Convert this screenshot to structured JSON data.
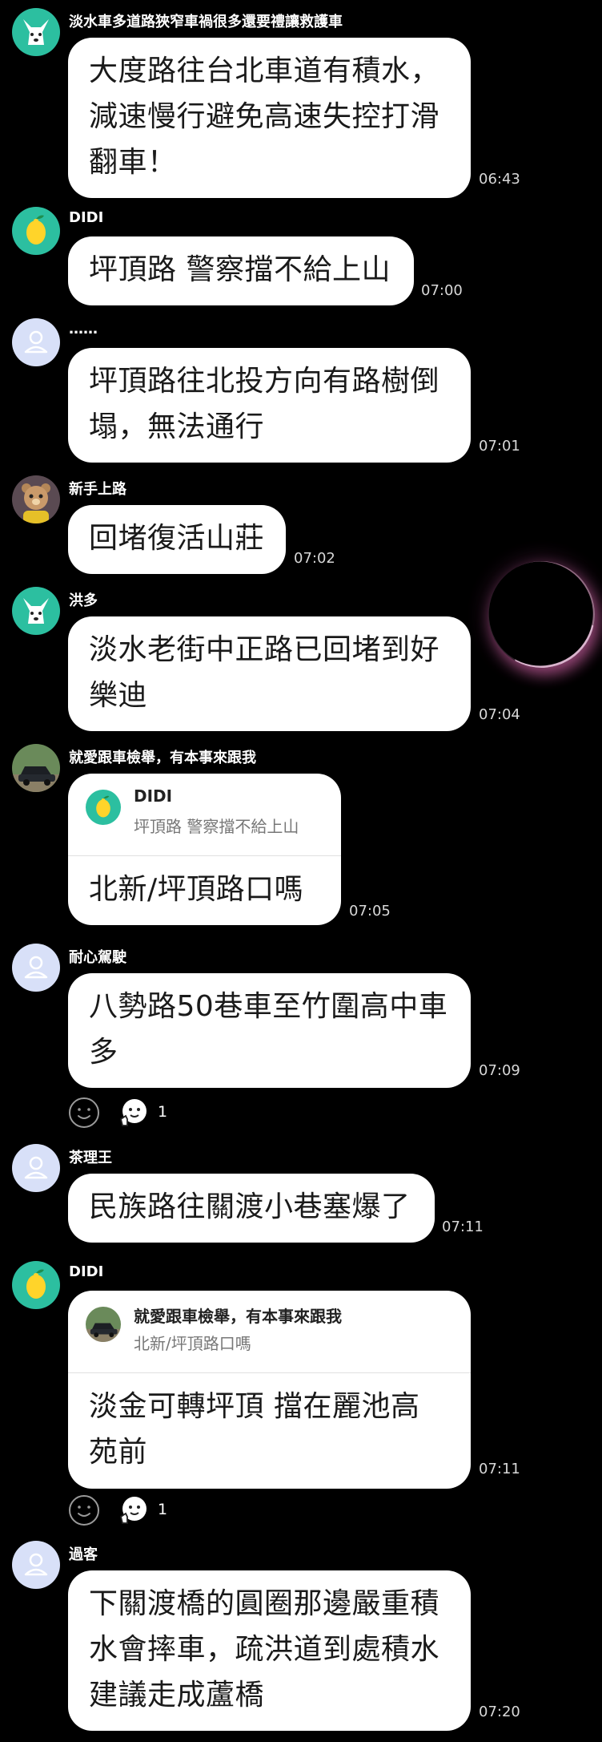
{
  "messages": [
    {
      "name": "淡水車多道路狹窄車禍很多還要禮讓救護車",
      "lines": [
        "大度路往台北車道有積水，",
        "減速慢行避免高速失控打滑",
        "翻車！"
      ],
      "time": "06:43",
      "avatar_icon": "dog-avatar-icon"
    },
    {
      "name": "DIDI",
      "lines": [
        "坪頂路 警察擋不給上山"
      ],
      "time": "07:00",
      "avatar_icon": "lemon-avatar-icon"
    },
    {
      "name": "……",
      "lines": [
        "坪頂路往北投方向有路樹倒",
        "塌，無法通行"
      ],
      "time": "07:01",
      "avatar_icon": "default-person-avatar-icon"
    },
    {
      "name": "新手上路",
      "lines": [
        "回堵復活山莊"
      ],
      "time": "07:02",
      "avatar_icon": "bear-avatar-icon"
    },
    {
      "name": "洪多",
      "lines": [
        "淡水老街中正路已回堵到好",
        "樂迪"
      ],
      "time": "07:04",
      "avatar_icon": "dog-avatar-icon"
    },
    {
      "name": "就愛跟車檢舉，有本事來跟我",
      "reply": {
        "name": "DIDI",
        "text": "坪頂路 警察擋不給上山",
        "icon": "lemon-avatar-icon"
      },
      "lines": [
        "北新/坪頂路口嗎"
      ],
      "time": "07:05",
      "avatar_icon": "car-avatar-icon"
    },
    {
      "name": "耐心駕駛",
      "lines": [
        "八勢路50巷車至竹圍高中車",
        "多"
      ],
      "time": "07:09",
      "avatar_icon": "default-person-avatar-icon",
      "reaction": {
        "count": "1",
        "icon": "thumbs-up-emoji-icon"
      }
    },
    {
      "name": "茶理王",
      "lines": [
        "民族路往關渡小巷塞爆了"
      ],
      "time": "07:11",
      "avatar_icon": "default-person-avatar-icon"
    },
    {
      "name": "DIDI",
      "reply": {
        "name": "就愛跟車檢舉，有本事來跟我",
        "text": "北新/坪頂路口嗎",
        "icon": "car-avatar-icon"
      },
      "lines": [
        "淡金可轉坪頂 擋在麗池高",
        "苑前"
      ],
      "time": "07:11",
      "avatar_icon": "lemon-avatar-icon",
      "reaction": {
        "count": "1",
        "icon": "thumbs-up-emoji-icon"
      }
    },
    {
      "name": "過客",
      "lines": [
        "下關渡橋的圓圈那邊嚴重積",
        "水會摔車，疏洪道到處積水",
        "建議走成蘆橋"
      ],
      "time": "07:20",
      "avatar_icon": "default-person-avatar-icon"
    }
  ]
}
